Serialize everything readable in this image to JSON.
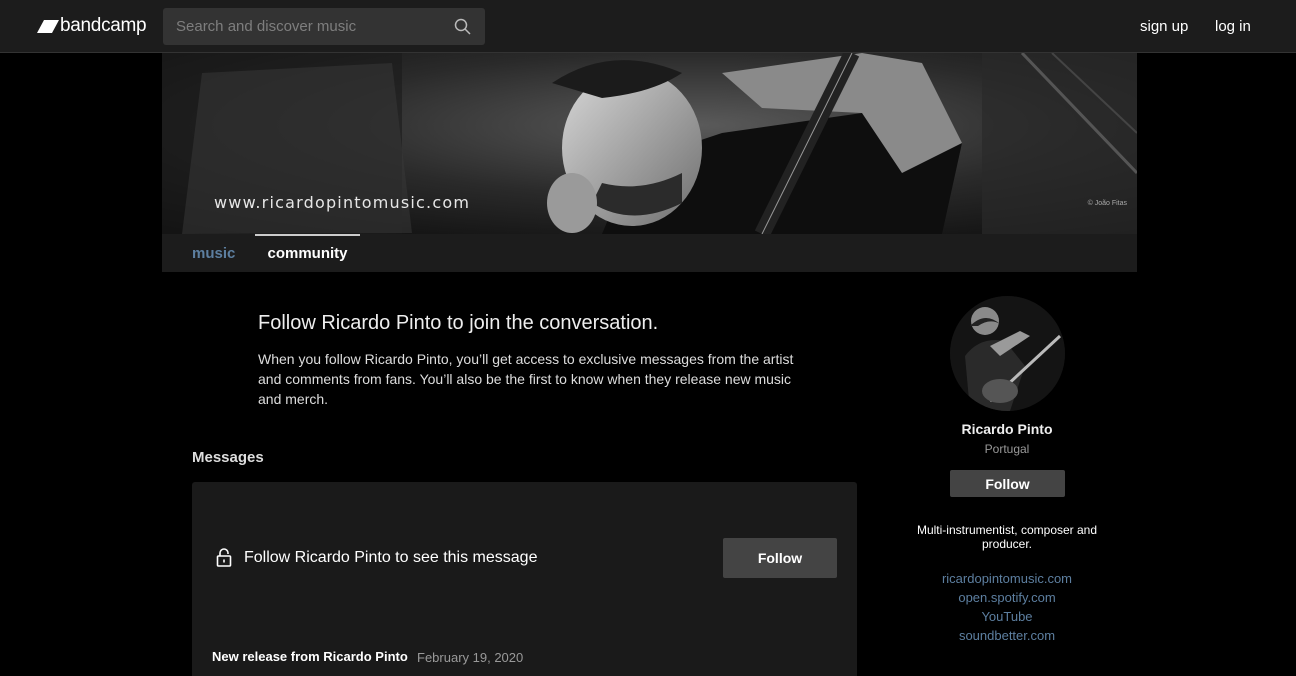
{
  "header": {
    "logo_text": "bandcamp",
    "search_placeholder": "Search and discover music",
    "signup": "sign up",
    "login": "log in"
  },
  "banner": {
    "url_text": "www.ricardopintomusic.com",
    "credit": "© João Fitas"
  },
  "tabs": [
    {
      "label": "music"
    },
    {
      "label": "community"
    }
  ],
  "intro": {
    "title": "Follow Ricardo Pinto to join the conversation.",
    "body": "When you follow Ricardo Pinto, you’ll get access to exclusive messages from the artist and comments from fans. You’ll also be the first to know when they release new music and merch."
  },
  "messages": {
    "heading": "Messages",
    "locked_text": "Follow Ricardo Pinto to see this message",
    "follow_label": "Follow",
    "release_title": "New release from Ricardo Pinto",
    "release_date": "February 19, 2020"
  },
  "sidebar": {
    "artist_name": "Ricardo Pinto",
    "location": "Portugal",
    "follow_label": "Follow",
    "bio": "Multi-instrumentist, composer and producer.",
    "links": [
      "ricardopintomusic.com",
      "open.spotify.com",
      "YouTube",
      "soundbetter.com"
    ]
  },
  "colors": {
    "link": "#5d7fa0",
    "nav_bg": "#1c1c1c",
    "button_bg": "#444444"
  },
  "icons": [
    "bandcamp-logo-icon",
    "search-icon",
    "lock-icon"
  ]
}
